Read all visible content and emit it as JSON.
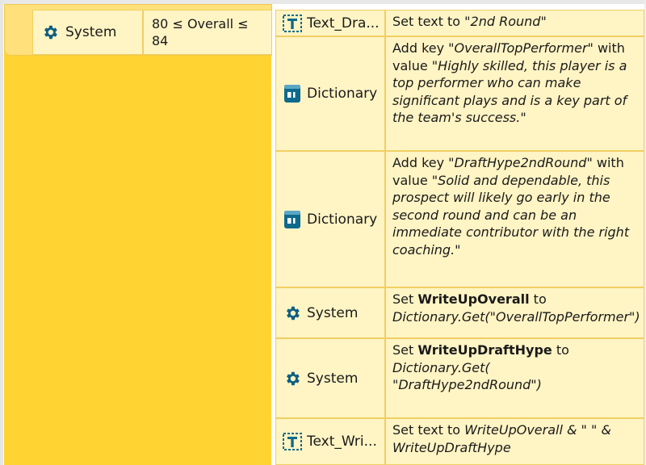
{
  "colors": {
    "block": "#ffd332",
    "cell": "#fff4c4",
    "cell_border": "#f0cf62",
    "system_icon": "#0e5f82",
    "dictionary_icon": "#0e6a8c",
    "text_icon": "#0e6a8c"
  },
  "condition": {
    "object": {
      "label": "System",
      "icon": "gear-icon"
    },
    "text": "80 ≤ Overall ≤ 84"
  },
  "actions": [
    {
      "object": "Text_Dra...",
      "icon": "text-object-icon",
      "parts": [
        {
          "t": "Set text to \""
        },
        {
          "t": "2nd Round",
          "i": true
        },
        {
          "t": "\""
        }
      ]
    },
    {
      "object": "Dictionary",
      "icon": "dictionary-icon",
      "parts": [
        {
          "t": "Add key \""
        },
        {
          "t": "OverallTopPerformer",
          "i": true
        },
        {
          "t": "\" with value \""
        },
        {
          "t": "Highly skilled, this player is a top performer who can make significant plays and is a key part of the team's success.",
          "i": true
        },
        {
          "t": "\""
        }
      ]
    },
    {
      "object": "Dictionary",
      "icon": "dictionary-icon",
      "parts": [
        {
          "t": "Add key \""
        },
        {
          "t": "DraftHype2ndRound",
          "i": true
        },
        {
          "t": "\" with value \""
        },
        {
          "t": "Solid and dependable, this prospect will likely go early in the second round and can be an immediate contributor with the right coaching.",
          "i": true
        },
        {
          "t": "\""
        }
      ]
    },
    {
      "object": "System",
      "icon": "gear-icon",
      "parts": [
        {
          "t": "Set "
        },
        {
          "t": "WriteUpOverall",
          "b": true
        },
        {
          "t": " to "
        },
        {
          "t": "Dictionary.Get(\"OverallTopPerformer\")",
          "i": true
        }
      ]
    },
    {
      "object": "System",
      "icon": "gear-icon",
      "parts": [
        {
          "t": "Set "
        },
        {
          "t": "WriteUpDraftHype",
          "b": true
        },
        {
          "t": " to "
        },
        {
          "t": "Dictionary.Get( \"DraftHype2ndRound\")",
          "i": true
        }
      ]
    },
    {
      "object": "Text_Wri...",
      "icon": "text-object-icon",
      "parts": [
        {
          "t": "Set text to "
        },
        {
          "t": "WriteUpOverall & \" \" & WriteUpDraftHype",
          "i": true
        }
      ]
    }
  ]
}
